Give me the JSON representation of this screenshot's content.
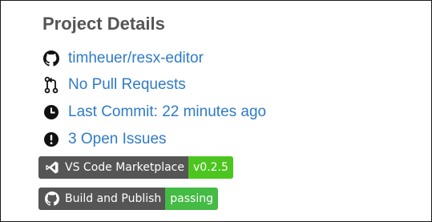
{
  "section": {
    "title": "Project Details"
  },
  "links": [
    {
      "icon": "github-icon",
      "label": "timheuer/resx-editor"
    },
    {
      "icon": "pull-request-icon",
      "label": "No Pull Requests"
    },
    {
      "icon": "clock-icon",
      "label": "Last Commit: 22 minutes ago"
    },
    {
      "icon": "issue-icon",
      "label": "3 Open Issues"
    }
  ],
  "badges": [
    {
      "icon": "vscode-icon",
      "label": "VS Code Marketplace",
      "value": "v0.2.5",
      "value_color": "#4cc61e"
    },
    {
      "icon": "github-icon",
      "label": "Build and Publish",
      "value": "passing",
      "value_color": "#44bb44"
    }
  ],
  "colors": {
    "link": "#2f7bc6",
    "title": "#555555",
    "badge_label_bg": "#555555"
  }
}
